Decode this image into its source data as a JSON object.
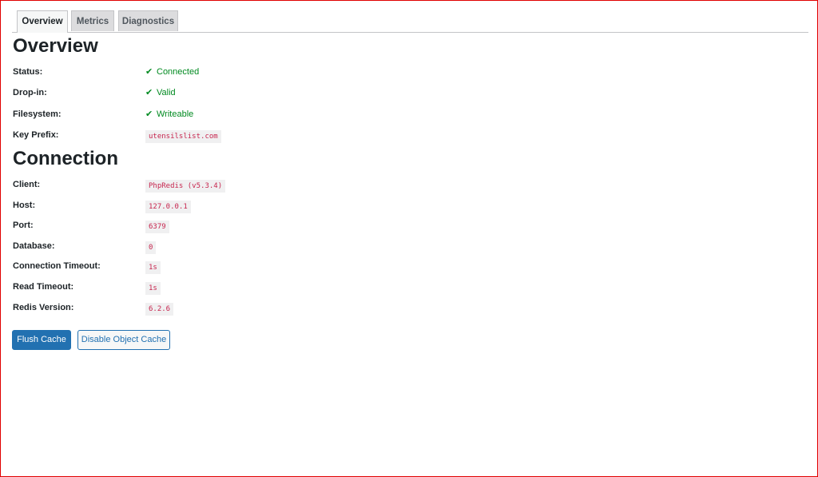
{
  "tabs": [
    {
      "label": "Overview",
      "active": true
    },
    {
      "label": "Metrics",
      "active": false
    },
    {
      "label": "Diagnostics",
      "active": false
    }
  ],
  "overview": {
    "title": "Overview",
    "rows": [
      {
        "label": "Status:",
        "value": "Connected",
        "icon": "checkmark-icon"
      },
      {
        "label": "Drop-in:",
        "value": "Valid",
        "icon": "checkmark-icon"
      },
      {
        "label": "Filesystem:",
        "value": "Writeable",
        "icon": "checkmark-icon"
      },
      {
        "label": "Key Prefix:",
        "value": "utensilslist.com"
      }
    ]
  },
  "connection": {
    "title": "Connection",
    "rows": [
      {
        "label": "Client:",
        "value": "PhpRedis (v5.3.4)"
      },
      {
        "label": "Host:",
        "value": "127.0.0.1"
      },
      {
        "label": "Port:",
        "value": "6379"
      },
      {
        "label": "Database:",
        "value": "0"
      },
      {
        "label": "Connection Timeout:",
        "value": "1s"
      },
      {
        "label": "Read Timeout:",
        "value": "1s"
      },
      {
        "label": "Redis Version:",
        "value": "6.2.6"
      }
    ]
  },
  "actions": {
    "flush_label": "Flush Cache",
    "disable_label": "Disable Object Cache"
  },
  "colors": {
    "accent": "#2271b1",
    "success": "#008a20",
    "code": "#c7254e",
    "frame": "#e00000"
  }
}
